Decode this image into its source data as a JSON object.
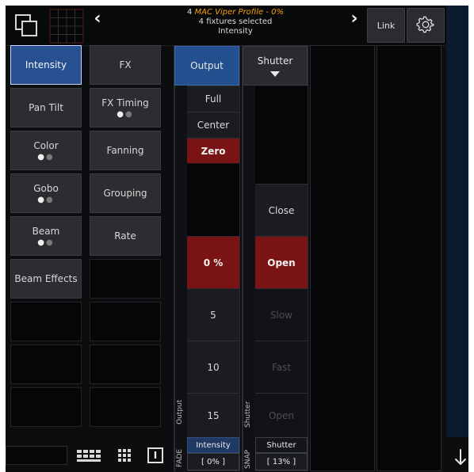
{
  "top": {
    "left_icons": [
      "windows-icon",
      "grid-icon"
    ],
    "title_line1_prefix": "4",
    "title_line1_profile": "MAC Viper Profile -",
    "title_line1_percent": "0%",
    "title_line2": "4 fixtures selected",
    "title_line3": "Intensity",
    "link_label": "Link",
    "settings_icon": "gear-icon",
    "nav_left_icon": "chevron-left-icon",
    "nav_right_icon": "chevron-right-icon"
  },
  "categories_left": [
    {
      "label": "Intensity",
      "active": true
    },
    {
      "label": "Pan Tilt"
    },
    {
      "label": "Color",
      "dots": "••"
    },
    {
      "label": "Gobo",
      "dots": "••"
    },
    {
      "label": "Beam",
      "dots": "••"
    },
    {
      "label": "Beam Effects"
    },
    {
      "label": ""
    },
    {
      "label": ""
    },
    {
      "label": ""
    }
  ],
  "categories_right": [
    {
      "label": "FX"
    },
    {
      "label": "FX Timing",
      "dots": "••"
    },
    {
      "label": "Fanning"
    },
    {
      "label": "Grouping"
    },
    {
      "label": "Rate"
    },
    {
      "label": ""
    },
    {
      "label": ""
    },
    {
      "label": ""
    },
    {
      "label": ""
    }
  ],
  "output_panel": {
    "header": "Output",
    "buttons": [
      "Full",
      "Center",
      "Zero"
    ],
    "current": "0 %",
    "values": [
      "5",
      "10",
      "15"
    ],
    "side_label": "Output",
    "fade_label": "FADE",
    "footer_title": "Intensity",
    "footer_value": "[ 0% ]"
  },
  "shutter_panel": {
    "header": "Shutter",
    "options": [
      "Close",
      "Open",
      "Slow",
      "Fast",
      "Open"
    ],
    "side_label": "Shutter",
    "snap_label": "SNAP",
    "footer_title": "Shutter",
    "footer_value": "[ 13% ]"
  },
  "bottom_bar": {
    "icons": [
      "keypad-icon",
      "grid-icon",
      "info-icon"
    ],
    "info_symbol": "I",
    "down_arrow_icon": "arrow-down-icon"
  }
}
